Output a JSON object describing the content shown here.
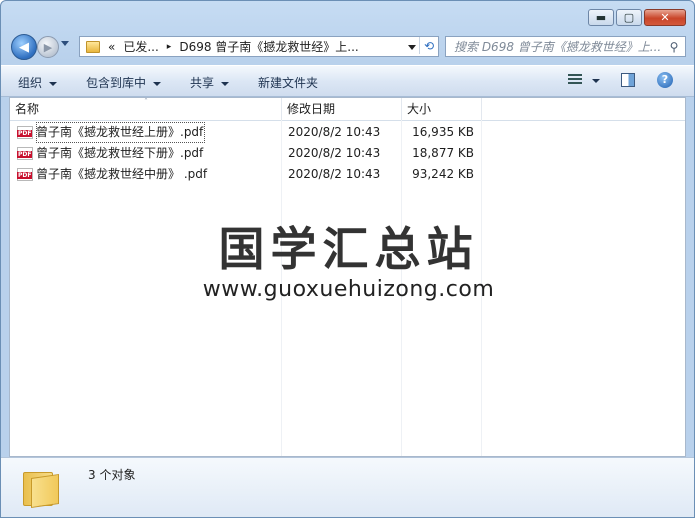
{
  "caption": {
    "minimize": "▬",
    "maximize": "▢",
    "close": "✕"
  },
  "nav": {
    "back_glyph": "◀",
    "forward_glyph": "▶",
    "address": {
      "overflow": "«",
      "segment1": "已发...",
      "separator": "▸",
      "segment2": "D698 曾子南《撼龙救世经》上..."
    },
    "refresh_glyph": "⟲",
    "search_placeholder": "搜索 D698 曾子南《撼龙救世经》上...",
    "search_glyph": "⚲"
  },
  "toolbar": {
    "organize": "组织",
    "include_library": "包含到库中",
    "share": "共享",
    "new_folder": "新建文件夹",
    "help": "?"
  },
  "columns": {
    "name": "名称",
    "date": "修改日期",
    "size": "大小",
    "sort_glyph": "˄"
  },
  "files": [
    {
      "name": "曾子南《撼龙救世经上册》.pdf",
      "date": "2020/8/2 10:43",
      "size": "16,935 KB",
      "icon_label": "PDF"
    },
    {
      "name": "曾子南《撼龙救世经下册》.pdf",
      "date": "2020/8/2 10:43",
      "size": "18,877 KB",
      "icon_label": "PDF"
    },
    {
      "name": "曾子南《撼龙救世经中册》 .pdf",
      "date": "2020/8/2 10:43",
      "size": "93,242 KB",
      "icon_label": "PDF"
    }
  ],
  "watermark": {
    "chinese": "国学汇总站",
    "url": "www.guoxuehuizong.com"
  },
  "details": {
    "count": "3 个对象"
  },
  "icons": [
    "back-arrow-icon",
    "forward-arrow-icon",
    "folder-icon",
    "refresh-icon",
    "search-icon",
    "view-list-icon",
    "preview-pane-icon",
    "help-icon",
    "pdf-file-icon",
    "large-folder-icon"
  ]
}
